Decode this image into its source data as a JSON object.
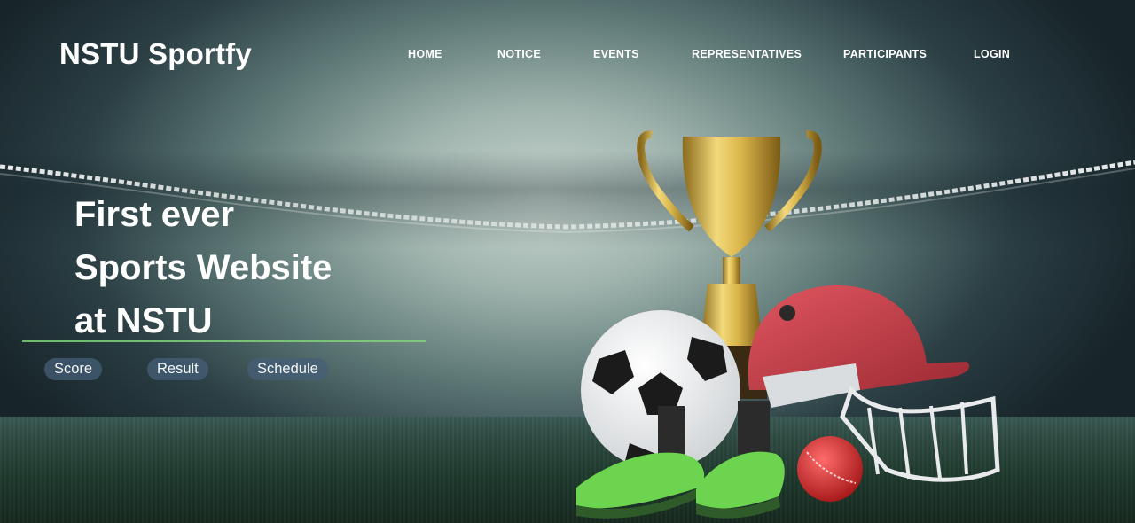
{
  "header": {
    "brand": "NSTU Sportfy",
    "nav": [
      {
        "label": "HOME"
      },
      {
        "label": "NOTICE"
      },
      {
        "label": "EVENTS"
      },
      {
        "label": "REPRESENTATIVES"
      },
      {
        "label": "PARTICIPANTS"
      },
      {
        "label": "LOGIN"
      }
    ]
  },
  "hero": {
    "lines": [
      "First ever",
      "Sports Website",
      "at NSTU"
    ]
  },
  "buttons": {
    "score": "Score",
    "result": "Result",
    "schedule": "Schedule"
  },
  "colors": {
    "accent_line": "#6dbb6a",
    "pill_bg": "#465f78"
  },
  "hero_image": {
    "items": [
      "trophy-icon",
      "soccer-ball-icon",
      "cricket-helmet-icon",
      "cricket-ball-icon",
      "football-boots-icon"
    ]
  }
}
